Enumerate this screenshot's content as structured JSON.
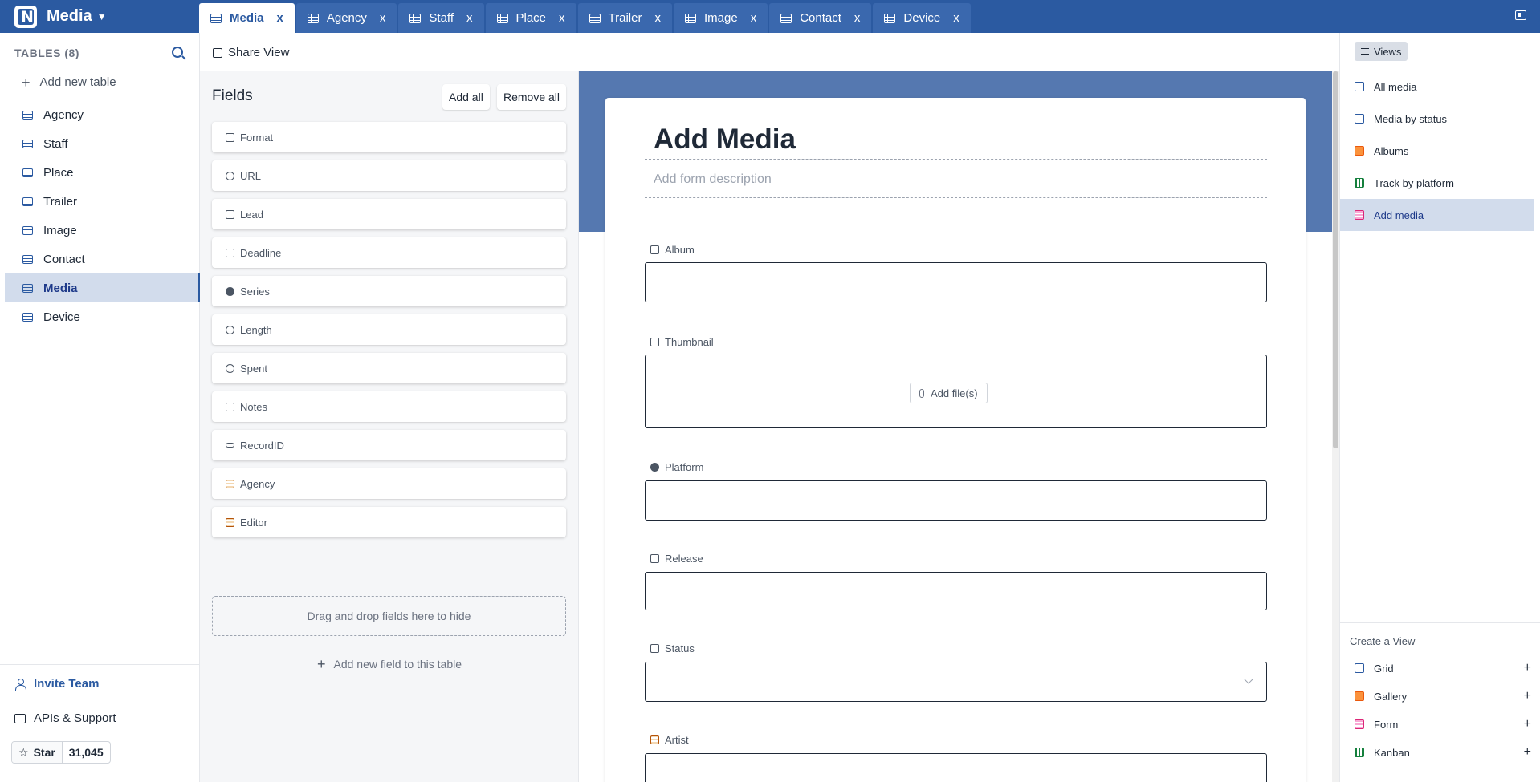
{
  "header": {
    "logo_letter": "N",
    "project_title": "Media",
    "tabs": [
      {
        "label": "Media",
        "active": true
      },
      {
        "label": "Agency"
      },
      {
        "label": "Staff"
      },
      {
        "label": "Place"
      },
      {
        "label": "Trailer"
      },
      {
        "label": "Image"
      },
      {
        "label": "Contact"
      },
      {
        "label": "Device"
      }
    ],
    "close_glyph": "x"
  },
  "sidebar": {
    "tables_heading": "TABLES (8)",
    "add_table_label": "Add new table",
    "tables": [
      "Agency",
      "Staff",
      "Place",
      "Trailer",
      "Image",
      "Contact",
      "Media",
      "Device"
    ],
    "active_table": "Media",
    "invite_label": "Invite Team",
    "apis_label": "APIs & Support",
    "star_label": "Star",
    "star_count": "31,045"
  },
  "toolbar": {
    "share_label": "Share View"
  },
  "fields_panel": {
    "title": "Fields",
    "add_all_label": "Add all",
    "remove_all_label": "Remove all",
    "fields": [
      {
        "label": "Format",
        "icon": "list-icon"
      },
      {
        "label": "URL",
        "icon": "globe-icon"
      },
      {
        "label": "Lead",
        "icon": "user-icon"
      },
      {
        "label": "Deadline",
        "icon": "calendar-icon"
      },
      {
        "label": "Series",
        "icon": "dropdown-icon"
      },
      {
        "label": "Length",
        "icon": "timer-icon"
      },
      {
        "label": "Spent",
        "icon": "currency-icon"
      },
      {
        "label": "Notes",
        "icon": "text-icon"
      },
      {
        "label": "RecordID",
        "icon": "infinity-icon"
      },
      {
        "label": "Agency",
        "icon": "table-link-icon"
      },
      {
        "label": "Editor",
        "icon": "table-link-icon"
      }
    ],
    "dropzone_label": "Drag and drop fields here to hide",
    "add_field_label": "Add new field to this table"
  },
  "form": {
    "title": "Add Media",
    "description_placeholder": "Add form description",
    "fields": [
      {
        "label": "Album",
        "icon": "link-icon"
      },
      {
        "label": "Thumbnail",
        "icon": "image-icon",
        "button": "Add file(s)"
      },
      {
        "label": "Platform",
        "icon": "dropdown-icon"
      },
      {
        "label": "Release",
        "icon": "calendar-icon"
      },
      {
        "label": "Status",
        "icon": "list-icon"
      },
      {
        "label": "Artist",
        "icon": "table-link-icon"
      }
    ]
  },
  "views_panel": {
    "button_label": "Views",
    "views": [
      {
        "label": "All media",
        "type": "grid"
      },
      {
        "label": "Media by status",
        "type": "grid"
      },
      {
        "label": "Albums",
        "type": "gallery"
      },
      {
        "label": "Track by platform",
        "type": "kanban"
      },
      {
        "label": "Add media",
        "type": "form",
        "active": true
      }
    ],
    "create_title": "Create a View",
    "create_items": [
      {
        "label": "Grid",
        "type": "grid"
      },
      {
        "label": "Gallery",
        "type": "gallery"
      },
      {
        "label": "Form",
        "type": "form"
      },
      {
        "label": "Kanban",
        "type": "kanban"
      }
    ],
    "plus_glyph": "+"
  },
  "colors": {
    "brand": "#2b5aa1",
    "banner": "#5578b0",
    "active_bg": "#d2dcec"
  }
}
